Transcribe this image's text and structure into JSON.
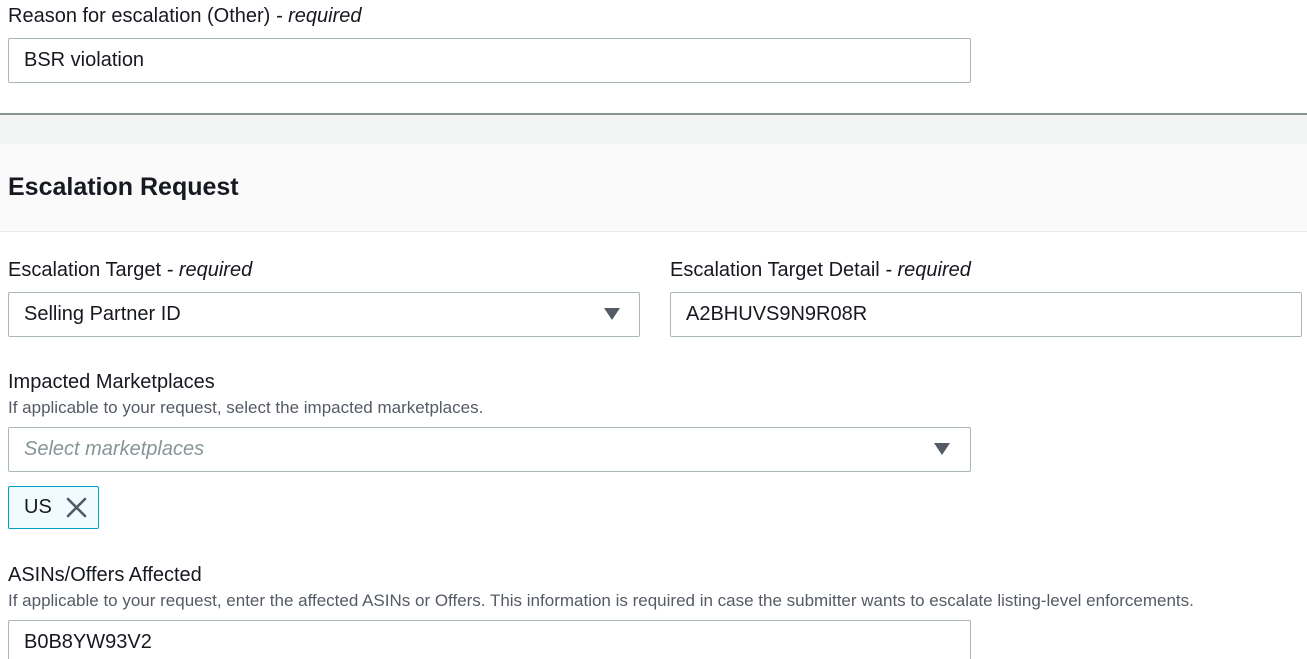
{
  "reason": {
    "label": "Reason for escalation (Other)",
    "required_marker": " - required",
    "value": "BSR violation"
  },
  "section": {
    "title": "Escalation Request"
  },
  "escalation_target": {
    "label": "Escalation Target",
    "required_marker": " - required",
    "selected": "Selling Partner ID"
  },
  "escalation_target_detail": {
    "label": "Escalation Target Detail",
    "required_marker": " - required",
    "value": "A2BHUVS9N9R08R"
  },
  "impacted_marketplaces": {
    "label": "Impacted Marketplaces",
    "hint": "If applicable to your request, select the impacted marketplaces.",
    "placeholder": "Select marketplaces",
    "tokens": [
      "US"
    ]
  },
  "asins": {
    "label": "ASINs/Offers Affected",
    "hint": "If applicable to your request, enter the affected ASINs or Offers. This information is required in case the submitter wants to escalate listing-level enforcements.",
    "value": "B0B8YW93V2"
  },
  "icons": {
    "dropdown": "caret-down-icon",
    "remove": "close-icon"
  },
  "colors": {
    "token_border": "#00a1c9",
    "token_background": "#f1faff",
    "field_border": "#aab7b8"
  }
}
